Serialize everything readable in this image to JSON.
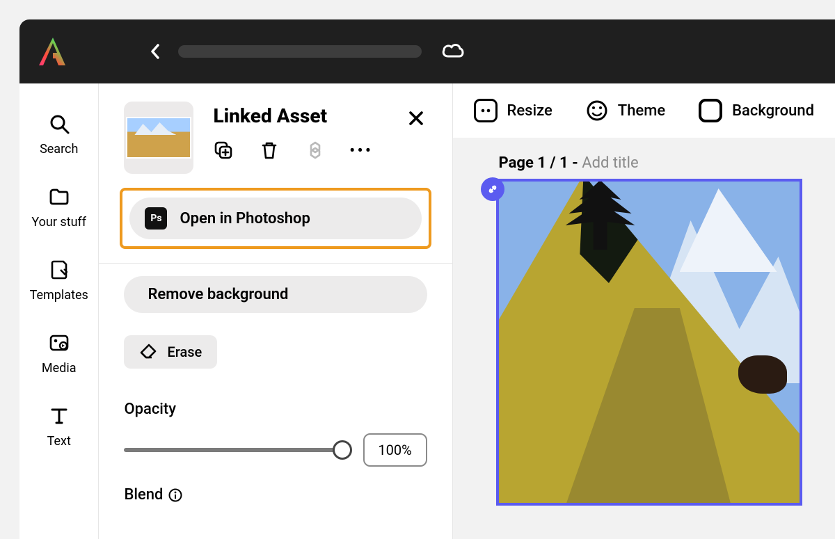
{
  "nav": {
    "search": "Search",
    "your_stuff": "Your stuff",
    "templates": "Templates",
    "media": "Media",
    "text": "Text"
  },
  "panel": {
    "title": "Linked Asset",
    "open_ps": "Open in Photoshop",
    "remove_bg": "Remove background",
    "erase": "Erase",
    "opacity_label": "Opacity",
    "opacity_value": "100%",
    "blend_label": "Blend"
  },
  "toolbar": {
    "resize": "Resize",
    "theme": "Theme",
    "background": "Background"
  },
  "page": {
    "prefix": "Page 1 / 1 - ",
    "placeholder": "Add title"
  }
}
